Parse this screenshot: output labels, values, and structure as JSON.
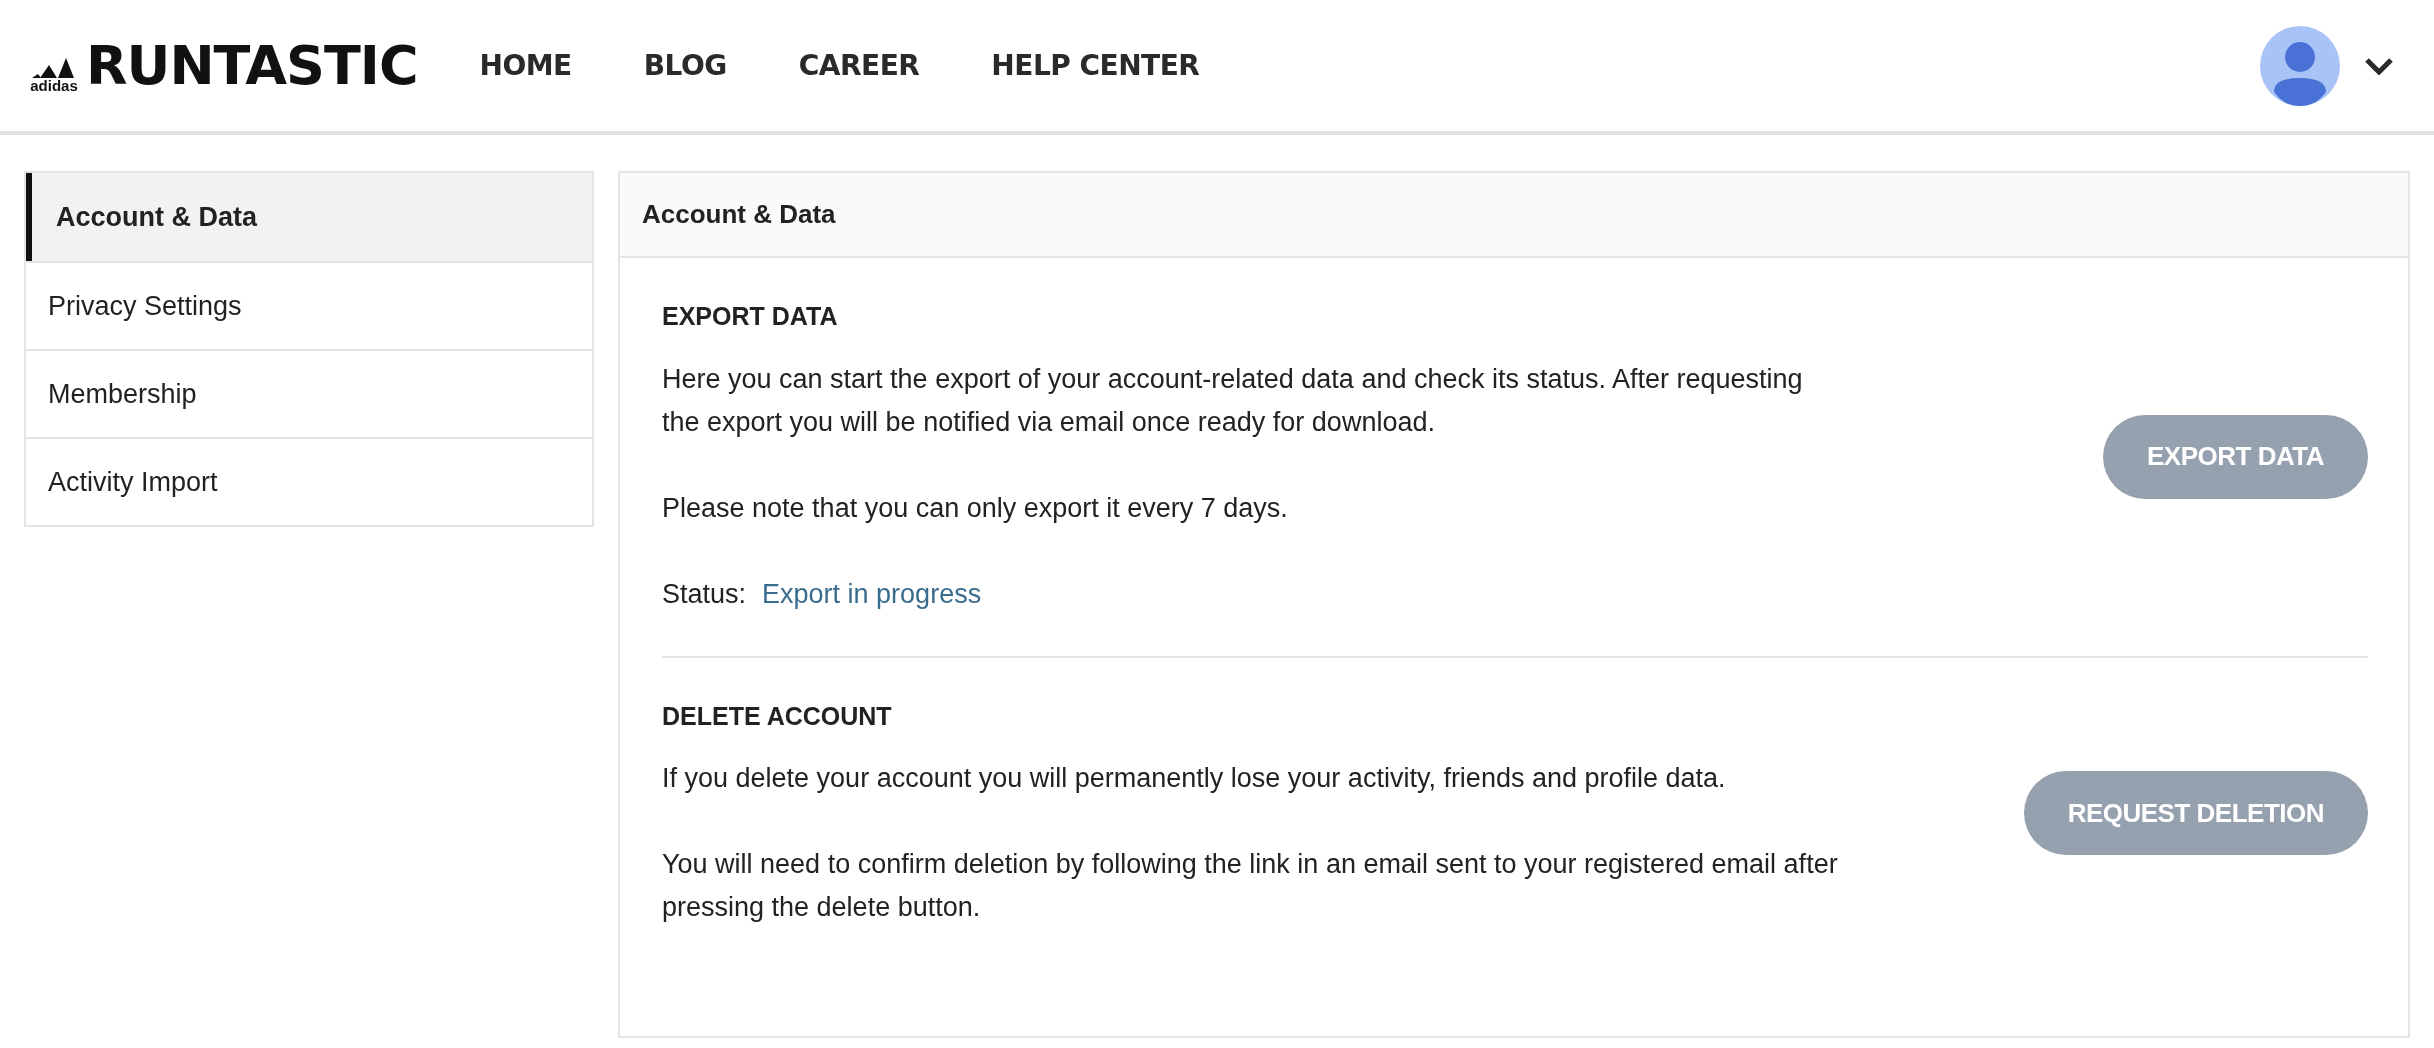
{
  "header": {
    "logo": {
      "brand_small": "adidas",
      "brand": "RUNTASTIC"
    },
    "nav": [
      {
        "label": "HOME"
      },
      {
        "label": "BLOG"
      },
      {
        "label": "CAREER"
      },
      {
        "label": "HELP CENTER"
      }
    ]
  },
  "sidebar": {
    "items": [
      {
        "label": "Account & Data",
        "selected": true
      },
      {
        "label": "Privacy Settings",
        "selected": false
      },
      {
        "label": "Membership",
        "selected": false
      },
      {
        "label": "Activity Import",
        "selected": false
      }
    ]
  },
  "panel": {
    "title": "Account & Data",
    "sections": [
      {
        "heading": "EXPORT DATA",
        "paragraphs": [
          "Here you can start the export of your account-related data and check its status. After requesting the export you will be notified via email once ready for download.",
          "Please note that you can only export it every 7 days."
        ],
        "status": {
          "label": "Status:",
          "value": "Export in progress"
        },
        "button": {
          "label": "EXPORT DATA",
          "disabled": true
        }
      },
      {
        "heading": "DELETE ACCOUNT",
        "paragraphs": [
          "If you delete your account you will permanently lose your activity, friends and profile data.",
          "You will need to confirm deletion by following the link in an email sent to your registered email after pressing the delete button."
        ],
        "button": {
          "label": "REQUEST DELETION",
          "disabled": true
        }
      }
    ]
  }
}
